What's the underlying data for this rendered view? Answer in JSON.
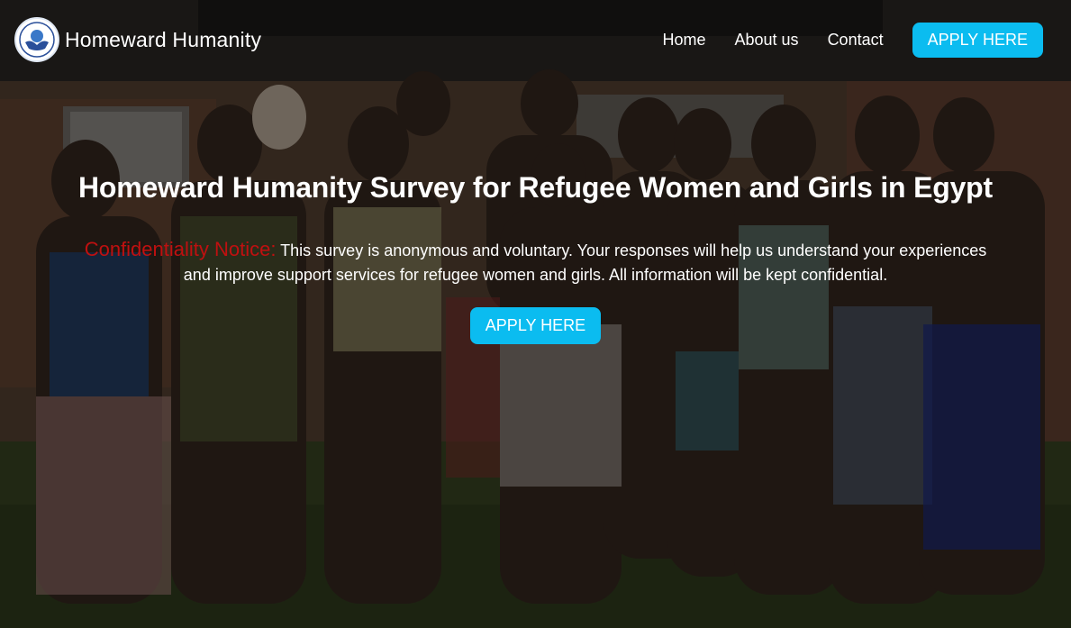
{
  "brand": {
    "name": "Homeward Humanity",
    "logo_icon": "hands-globe-logo-icon"
  },
  "nav": {
    "links": [
      {
        "label": "Home"
      },
      {
        "label": "About us"
      },
      {
        "label": "Contact"
      }
    ],
    "apply_label": "APPLY HERE"
  },
  "hero": {
    "title": "Homeward Humanity Survey for Refugee Women and Girls in Egypt",
    "notice_label": "Confidentiality Notice:",
    "notice_text": "This survey is anonymous and voluntary. Your responses will help us understand your experiences and improve support services for refugee women and girls. All information will be kept confidential.",
    "apply_label": "APPLY HERE"
  },
  "colors": {
    "accent": "#0bbcf0",
    "notice": "#c01010",
    "text": "#ffffff"
  }
}
